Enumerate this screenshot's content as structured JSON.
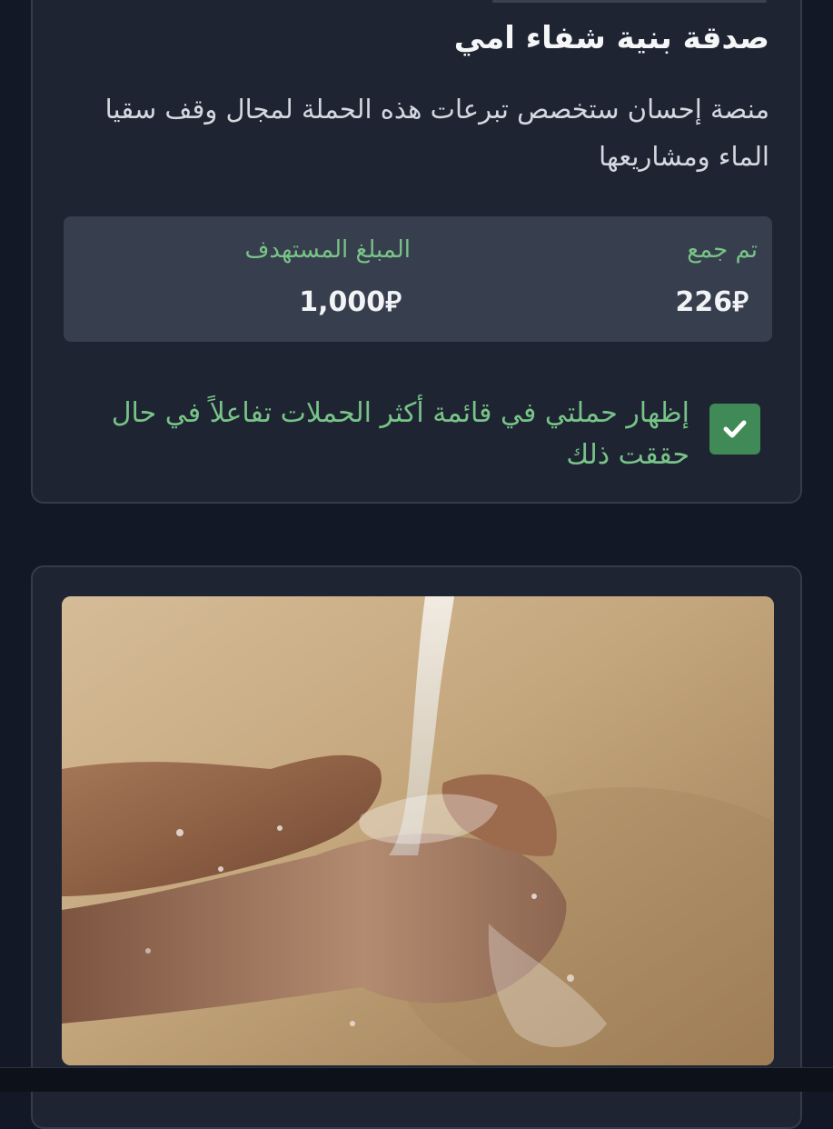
{
  "campaign": {
    "title": "صدقة بنية شفاء امي",
    "description": "منصة إحسان ستخصص تبرعات هذه الحملة لمجال وقف سقيا الماء ومشاريعها"
  },
  "stats": {
    "collected_label": "تم جمع",
    "collected_value": "226",
    "target_label": "المبلغ المستهدف",
    "target_value": "1,000",
    "currency_symbol": "⃁"
  },
  "consent": {
    "checked": true,
    "text": "إظهار حملتي في قائمة أكثر الحملات تفاعلاً في حال حققت ذلك"
  },
  "image": {
    "subject": "hands-water-photo"
  },
  "colors": {
    "background": "#121826",
    "card": "#1e2432",
    "stats_panel": "#373e4d",
    "accent_green": "#78c388",
    "checkbox_green": "#3f8a56"
  }
}
